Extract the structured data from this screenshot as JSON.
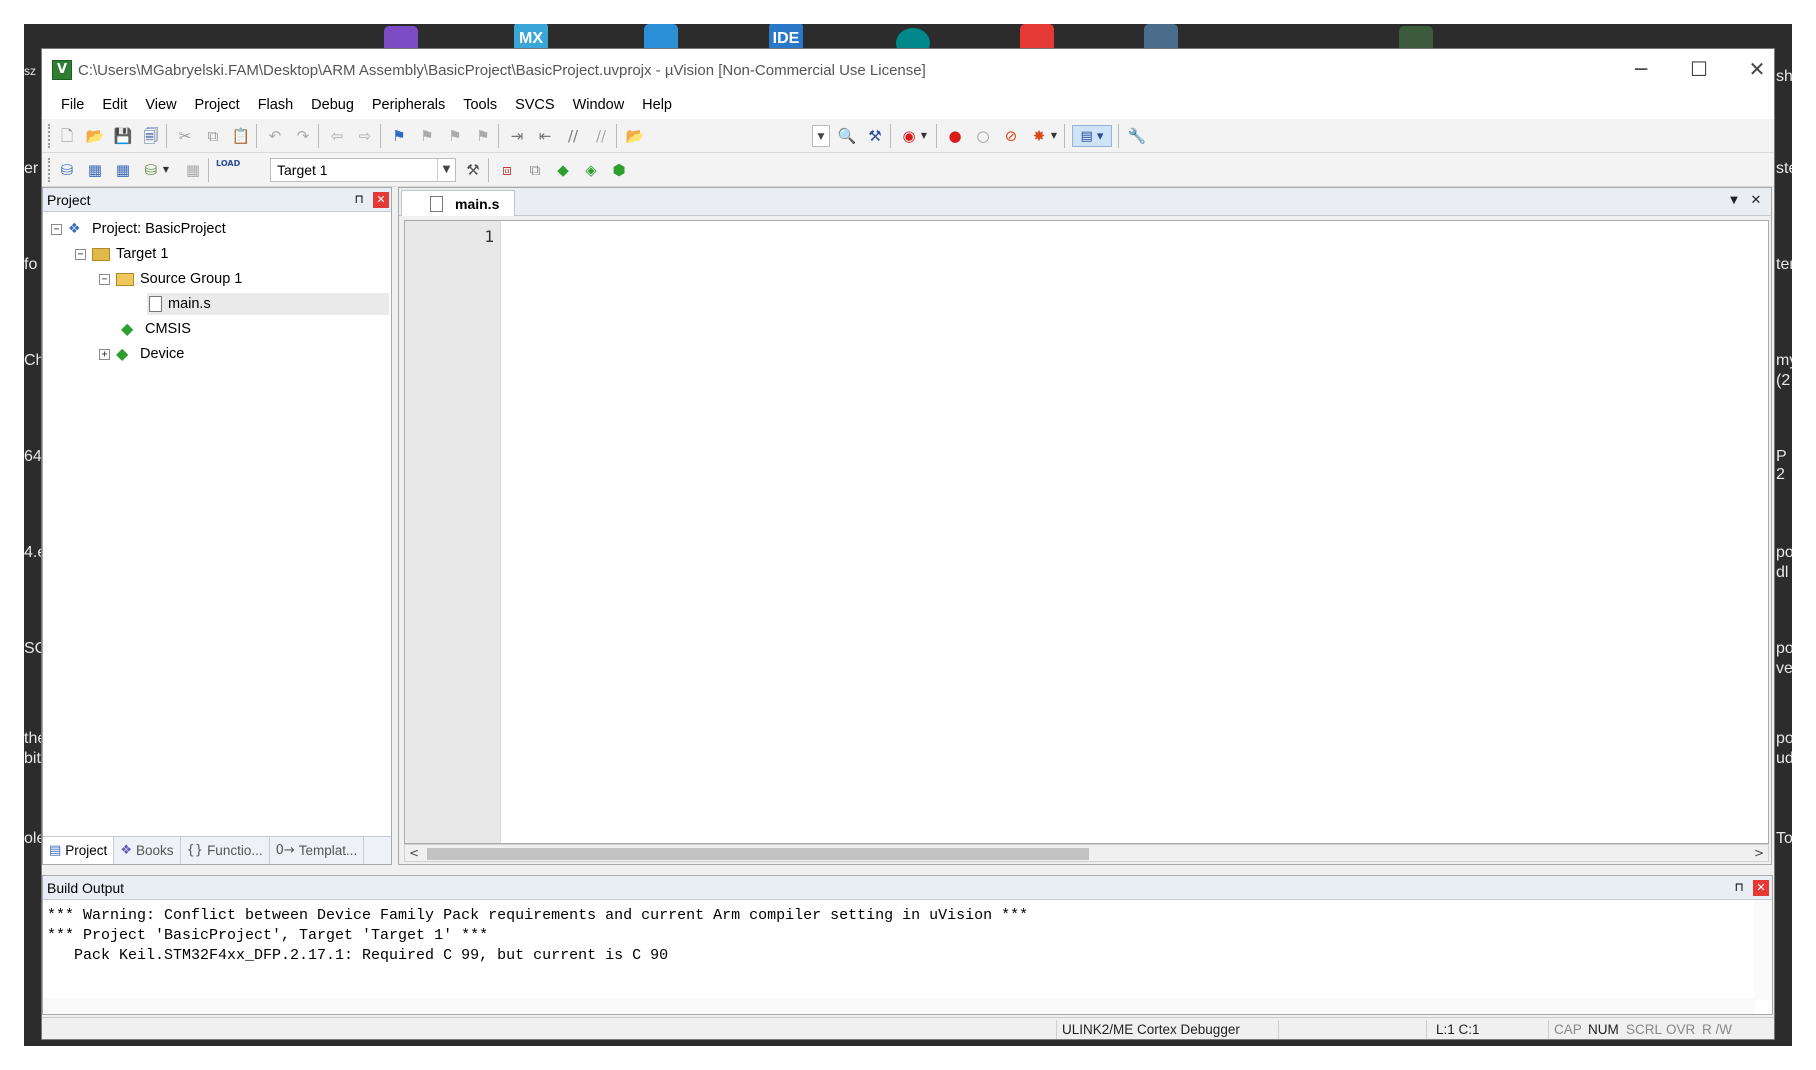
{
  "window": {
    "title": "C:\\Users\\MGabryelski.FAM\\Desktop\\ARM Assembly\\BasicProject\\BasicProject.uvprojx - µVision  [Non-Commercial Use License]",
    "app_icon_glyph": "V",
    "minimize": "─",
    "maximize": "☐",
    "close": "✕"
  },
  "desktop": {
    "taskbar_icons": [
      "MX",
      "IDE"
    ],
    "left_labels": [
      "sz",
      "er",
      "fo",
      "Ch",
      "64",
      "4.e",
      "SC",
      "the",
      "bit",
      "ole"
    ],
    "right_labels": [
      "sh",
      "ste",
      "ter",
      "my",
      "(2",
      "P 2",
      "po",
      "dl",
      "po",
      "ve",
      "po",
      "ud",
      "To"
    ]
  },
  "menu": [
    "File",
    "Edit",
    "View",
    "Project",
    "Flash",
    "Debug",
    "Peripherals",
    "Tools",
    "SVCS",
    "Window",
    "Help"
  ],
  "toolbar2": {
    "target": "Target 1",
    "load_label": "LOAD"
  },
  "project_pane": {
    "title": "Project",
    "pin": "⊓",
    "close": "✕",
    "tree": [
      {
        "label": "Project: BasicProject",
        "expander": "−"
      },
      {
        "label": "Target 1",
        "expander": "−"
      },
      {
        "label": "Source Group 1",
        "expander": "−"
      },
      {
        "label": "main.s",
        "expander": ""
      },
      {
        "label": "CMSIS",
        "expander": ""
      },
      {
        "label": "Device",
        "expander": "+"
      }
    ],
    "tabs": [
      "Project",
      "Books",
      "Functio...",
      "Templat..."
    ]
  },
  "editor": {
    "active_tab": "main.s",
    "line_numbers": [
      "1"
    ],
    "dropdown": "▼",
    "close": "✕",
    "scroll_left": "<",
    "scroll_right": ">"
  },
  "build_output": {
    "title": "Build Output",
    "pin": "⊓",
    "close": "✕",
    "lines": [
      "*** Warning: Conflict between Device Family Pack requirements and current Arm compiler setting in uVision ***",
      "*** Project 'BasicProject', Target 'Target 1' ***",
      "   Pack Keil.STM32F4xx_DFP.2.17.1: Required C 99, but current is C 90"
    ]
  },
  "status": {
    "debugger": "ULINK2/ME Cortex Debugger",
    "position": "L:1 C:1",
    "cap": "CAP",
    "num": "NUM",
    "scrl": "SCRL",
    "ovr": "OVR",
    "rw": "R /W"
  },
  "colors": {
    "accent_green": "#2e9e2e",
    "close_red": "#e53935",
    "breakpoint_red": "#d81b1b"
  }
}
